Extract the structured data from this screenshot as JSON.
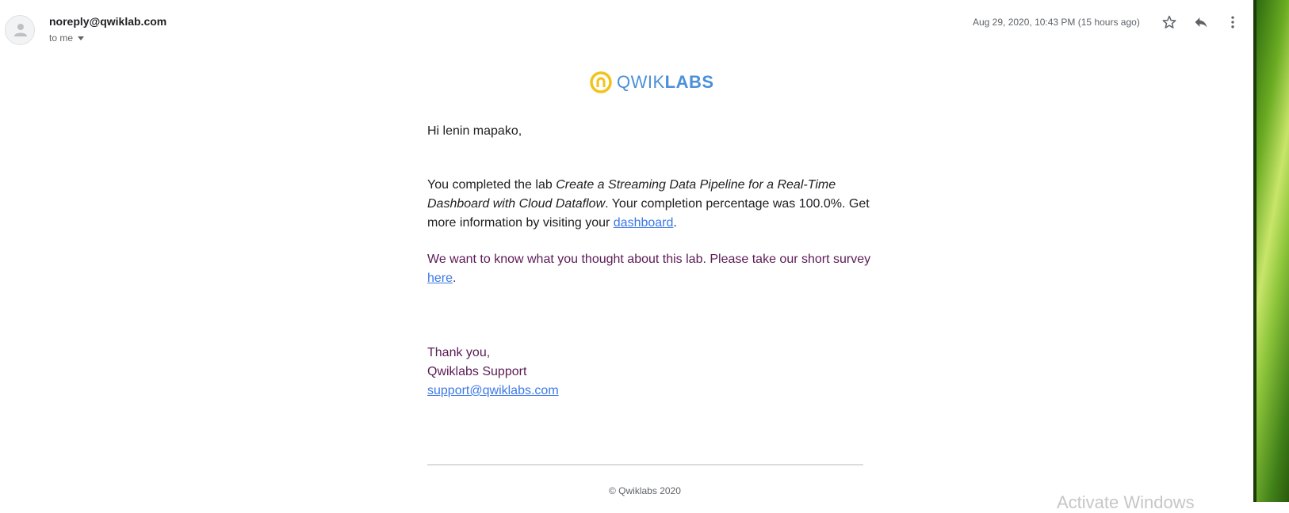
{
  "header": {
    "sender": "noreply@qwiklab.com",
    "recipient": "to me",
    "date": "Aug 29, 2020, 10:43 PM (15 hours ago)"
  },
  "logo": {
    "part1": "QWIK",
    "part2": "LABS"
  },
  "body": {
    "greeting": "Hi lenin mapako,",
    "p1_prefix": "You completed the lab ",
    "lab_name": "Create a Streaming Data Pipeline for a Real-Time Dashboard with Cloud Dataflow",
    "p1_mid": ". Your completion percentage was 100.0%. Get more information by visiting your ",
    "dashboard_link": "dashboard",
    "p1_suffix": ".",
    "p2_prefix": "We want to know what you thought about this lab. Please take our short survey ",
    "here_link": "here",
    "p2_suffix": ".",
    "thanks": "Thank you,",
    "signature": "Qwiklabs Support",
    "support_email": "support@qwiklabs.com"
  },
  "footer": {
    "copyright": "© Qwiklabs 2020"
  },
  "overlay": {
    "activate_text": "Activate Windows"
  },
  "colors": {
    "link": "#3b78e7",
    "purple_text": "#5c1a55",
    "logo_yellow": "#f2c319",
    "logo_blue": "#4a90d9"
  }
}
